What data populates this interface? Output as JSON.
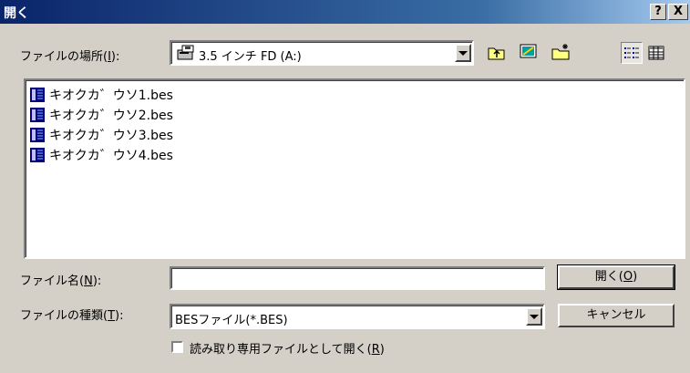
{
  "window": {
    "title": "開く",
    "help_label": "?",
    "close_label": "X"
  },
  "location": {
    "label_prefix": "ファイルの場所(",
    "label_key": "I",
    "label_suffix": "):",
    "value": "3.5 インチ FD (A:)"
  },
  "toolbar": {
    "icons": [
      "up-folder-icon",
      "desktop-icon",
      "new-folder-icon",
      "list-view-icon",
      "details-view-icon"
    ]
  },
  "files": [
    {
      "name": "キオクカ゛ウソ1.bes",
      "icon": "bes-file-icon"
    },
    {
      "name": "キオクカ゛ウソ2.bes",
      "icon": "bes-file-icon"
    },
    {
      "name": "キオクカ゛ウソ3.bes",
      "icon": "bes-file-icon"
    },
    {
      "name": "キオクカ゛ウソ4.bes",
      "icon": "bes-file-icon"
    }
  ],
  "filename": {
    "label_prefix": "ファイル名(",
    "label_key": "N",
    "label_suffix": "):",
    "value": ""
  },
  "filetype": {
    "label_prefix": "ファイルの種類(",
    "label_key": "T",
    "label_suffix": "):",
    "value": "BESファイル(*.BES)"
  },
  "readonly": {
    "label_prefix": "読み取り専用ファイルとして開く(",
    "label_key": "R",
    "label_suffix": ")",
    "checked": false
  },
  "buttons": {
    "open_prefix": "開く(",
    "open_key": "O",
    "open_suffix": ")",
    "cancel": "キャンセル"
  }
}
